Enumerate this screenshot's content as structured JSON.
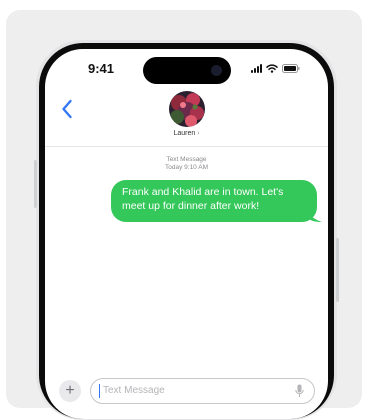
{
  "status_bar": {
    "time": "9:41"
  },
  "header": {
    "contact_name": "Lauren",
    "contact_chevron": "›"
  },
  "conversation": {
    "service_label": "Text Message",
    "timestamp": "Today 9:10 AM",
    "messages": [
      {
        "sender": "me",
        "text": "Frank and Khalid are in town. Let's meet up for dinner after work!"
      }
    ]
  },
  "composer": {
    "add_label": "+",
    "placeholder": "Text Message"
  },
  "colors": {
    "bubble_sent": "#34c759",
    "accent": "#3478f6"
  },
  "icons": [
    "chevron-left-icon",
    "cellular-signal-icon",
    "wifi-icon",
    "battery-icon",
    "plus-icon",
    "microphone-icon"
  ]
}
